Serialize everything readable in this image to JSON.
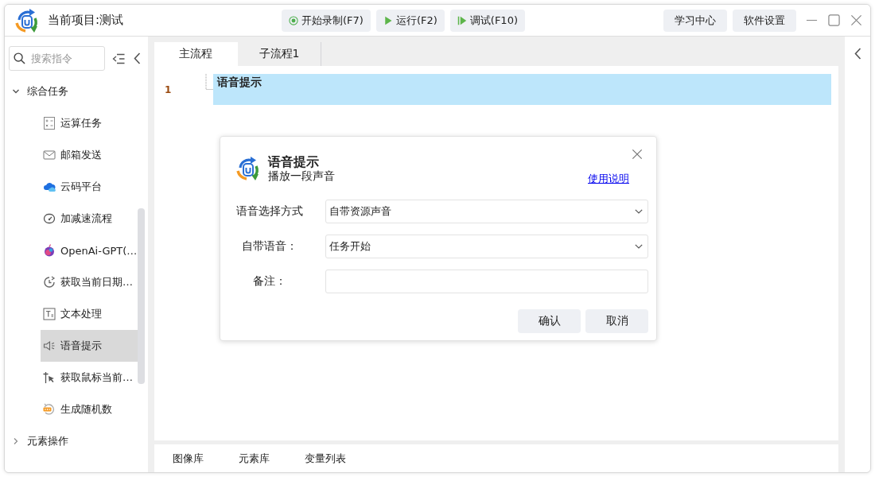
{
  "title_bar": {
    "project_title": "当前项目:测试",
    "toolbar_buttons": [
      "开始录制(F7)",
      "运行(F2)",
      "调试(F10)"
    ],
    "right_buttons": [
      "学习中心",
      "软件设置"
    ]
  },
  "sidebar": {
    "search": {
      "placeholder": "搜索指令"
    },
    "tree": [
      {
        "label": "综合任务",
        "expanded": true,
        "selected": false,
        "children": [
          {
            "label": "运算任务",
            "selected": false
          },
          {
            "label": "邮箱发送",
            "selected": false
          },
          {
            "label": "云码平台",
            "selected": false
          },
          {
            "label": "加减速流程",
            "selected": false
          },
          {
            "label": "OpenAi-GPT(…",
            "selected": false
          },
          {
            "label": "获取当前日期…",
            "selected": false
          },
          {
            "label": "文本处理",
            "selected": false
          },
          {
            "label": "语音提示",
            "selected": true
          },
          {
            "label": "获取鼠标当前…",
            "selected": false
          },
          {
            "label": "生成随机数",
            "selected": false
          }
        ]
      },
      {
        "label": "元素操作",
        "expanded": false,
        "selected": false
      }
    ]
  },
  "main_tabs": [
    {
      "label": "主流程",
      "selected": true
    },
    {
      "label": "子流程1",
      "selected": false
    }
  ],
  "editor": {
    "lines": [
      {
        "number": "1",
        "text": "语音提示",
        "selected": true
      }
    ]
  },
  "bottom_tabs": [
    {
      "label": "图像库",
      "selected": false
    },
    {
      "label": "元素库",
      "selected": false
    },
    {
      "label": "变量列表",
      "selected": false
    }
  ],
  "dialog": {
    "title": "语音提示",
    "subtitle": "播放一段声音",
    "help_link": "使用说明",
    "fields": [
      {
        "kind": "select",
        "label": "语音选择方式",
        "value": "自带资源声音"
      },
      {
        "kind": "select",
        "label": "自带语音：",
        "value": "任务开始"
      },
      {
        "kind": "input",
        "label": "备注："
      }
    ],
    "buttons": [
      "确认",
      "取消"
    ]
  }
}
